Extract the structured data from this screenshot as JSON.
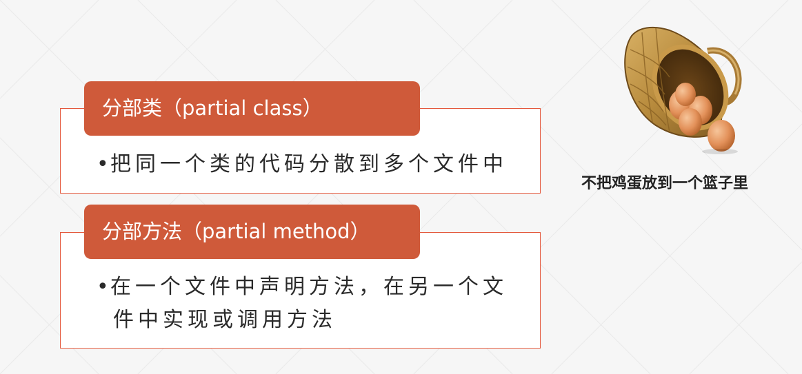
{
  "sections": [
    {
      "title": "分部类（partial class）",
      "bullets": [
        "把同一个类的代码分散到多个文件中"
      ]
    },
    {
      "title": "分部方法（partial method）",
      "bullets": [
        "在一个文件中声明方法，在另一个文",
        "件中实现或调用方法"
      ]
    }
  ],
  "bullet_symbol": "•",
  "image": {
    "caption": "不把鸡蛋放到一个篮子里",
    "icon": "egg-basket-illustration"
  },
  "colors": {
    "accent": "#cf5a3a",
    "border": "#e4583c",
    "background": "#f6f6f6",
    "text": "#2a2a2a"
  }
}
